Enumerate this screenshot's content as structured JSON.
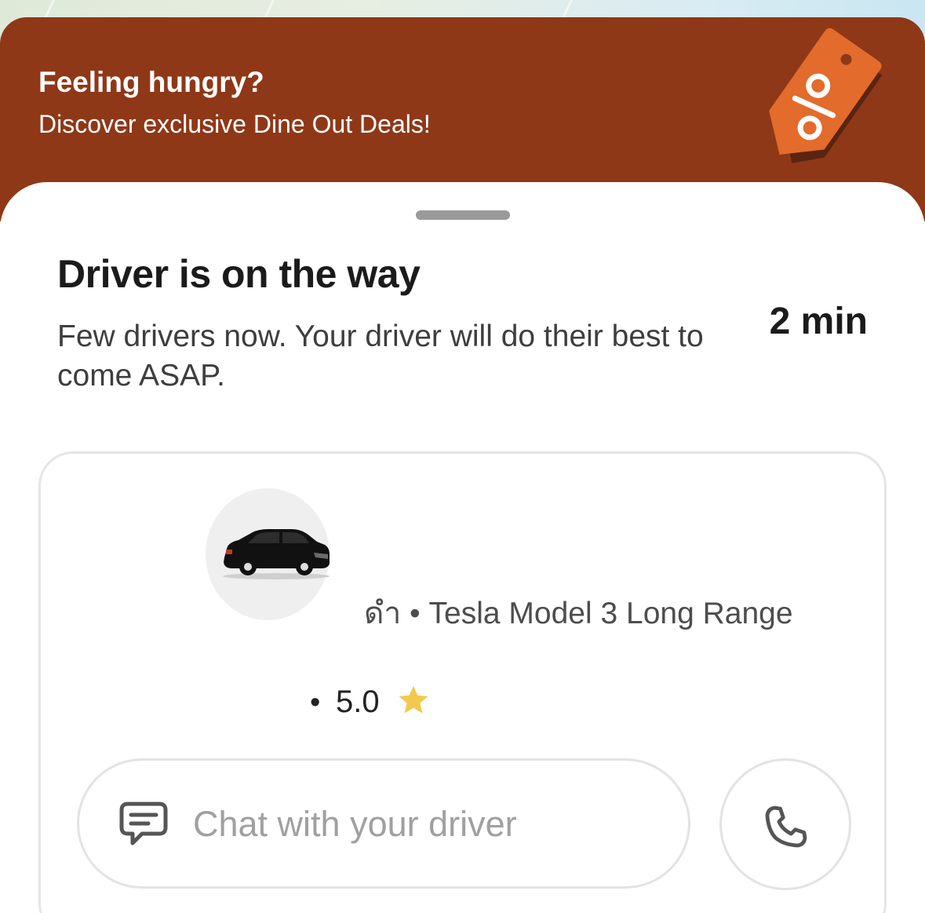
{
  "promo": {
    "title": "Feeling hungry?",
    "subtitle": "Discover exclusive Dine Out Deals!",
    "background_color": "#8e3818",
    "tag_icon": "discount-tag-icon",
    "tag_color": "#e36b2c"
  },
  "status": {
    "title": "Driver is on the way",
    "message": "Few drivers now. Your driver will do their best to come ASAP.",
    "eta": "2 min"
  },
  "driver_card": {
    "car_icon": "black-car-icon",
    "vehicle": "ดำ • Tesla Model 3 Long Range",
    "rating_separator": "•",
    "rating": "5.0",
    "rating_icon": "star-icon",
    "star_color": "#f2c94c"
  },
  "actions": {
    "chat_label": "Chat with your driver",
    "chat_icon": "chat-bubble-icon",
    "call_icon": "phone-icon"
  }
}
